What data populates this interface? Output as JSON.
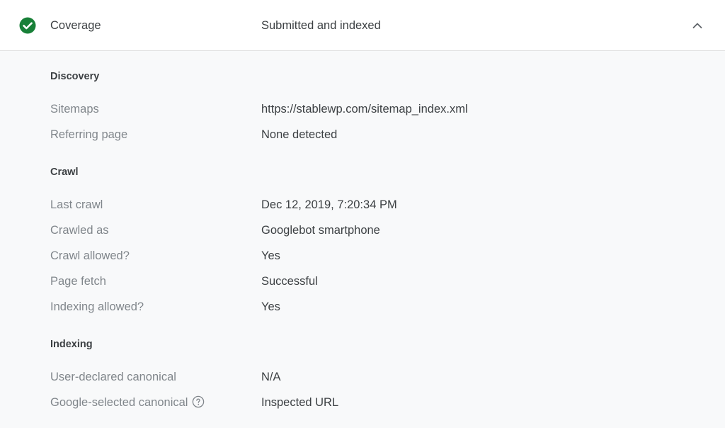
{
  "header": {
    "title": "Coverage",
    "status": "Submitted and indexed",
    "status_icon": "check-circle-icon",
    "status_color": "#188038",
    "toggle_icon": "chevron-up-icon"
  },
  "sections": [
    {
      "title": "Discovery",
      "rows": [
        {
          "label": "Sitemaps",
          "value": "https://stablewp.com/sitemap_index.xml"
        },
        {
          "label": "Referring page",
          "value": "None detected"
        }
      ]
    },
    {
      "title": "Crawl",
      "rows": [
        {
          "label": "Last crawl",
          "value": "Dec 12, 2019, 7:20:34 PM"
        },
        {
          "label": "Crawled as",
          "value": "Googlebot smartphone"
        },
        {
          "label": "Crawl allowed?",
          "value": "Yes"
        },
        {
          "label": "Page fetch",
          "value": "Successful"
        },
        {
          "label": "Indexing allowed?",
          "value": "Yes"
        }
      ]
    },
    {
      "title": "Indexing",
      "rows": [
        {
          "label": "User-declared canonical",
          "value": "N/A"
        },
        {
          "label": "Google-selected canonical",
          "value": "Inspected URL",
          "help_icon": "help-circle-icon"
        }
      ]
    }
  ]
}
